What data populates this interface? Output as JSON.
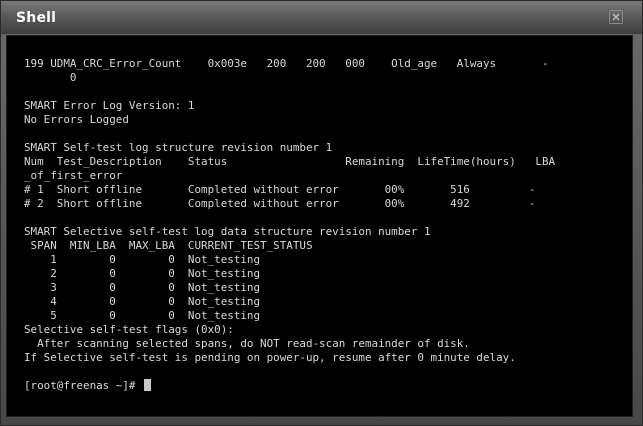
{
  "window": {
    "title": "Shell"
  },
  "terminal": {
    "lines": [
      "199 UDMA_CRC_Error_Count    0x003e   200   200   000    Old_age   Always       -",
      "       0",
      "",
      "SMART Error Log Version: 1",
      "No Errors Logged",
      "",
      "SMART Self-test log structure revision number 1",
      "Num  Test_Description    Status                  Remaining  LifeTime(hours)   LBA",
      "_of_first_error",
      "# 1  Short offline       Completed without error       00%       516         -",
      "# 2  Short offline       Completed without error       00%       492         -",
      "",
      "SMART Selective self-test log data structure revision number 1",
      " SPAN  MIN_LBA  MAX_LBA  CURRENT_TEST_STATUS",
      "    1        0        0  Not_testing",
      "    2        0        0  Not_testing",
      "    3        0        0  Not_testing",
      "    4        0        0  Not_testing",
      "    5        0        0  Not_testing",
      "Selective self-test flags (0x0):",
      "  After scanning selected spans, do NOT read-scan remainder of disk.",
      "If Selective self-test is pending on power-up, resume after 0 minute delay.",
      ""
    ],
    "prompt": "[root@freenas ~]# "
  },
  "icons": {
    "close": "close-icon"
  },
  "colors": {
    "terminal_bg": "#000000",
    "terminal_fg": "#d8d8d8",
    "titlebar": "#5a5a5a"
  }
}
